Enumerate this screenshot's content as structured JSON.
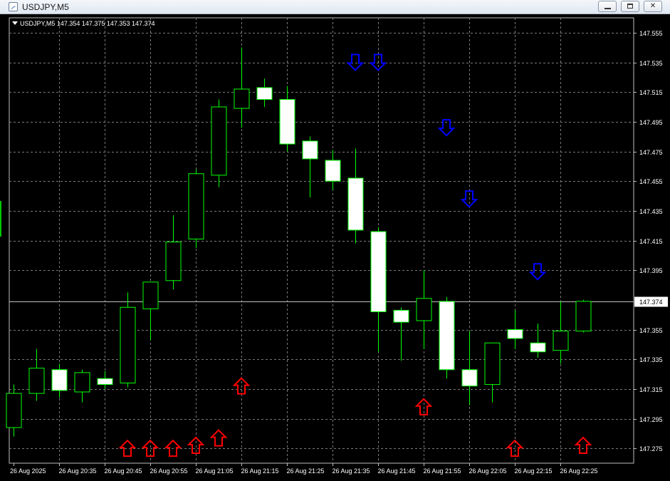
{
  "window": {
    "title": "USDJPY,M5"
  },
  "chart_header": {
    "symbol_line": "USDJPY,M5  147.354 147.375 147.353 147.374"
  },
  "colors": {
    "background": "#000000",
    "bull_body": "#000000",
    "bear_body": "#ffffff",
    "candle_outline": "#00ff00",
    "grid": "#7a7a7a",
    "axis_text": "#ffffff",
    "up_arrow": "#ff0000",
    "down_arrow": "#0000ff",
    "price_line": "#c0c0c0"
  },
  "chart_data": {
    "type": "candlestick",
    "symbol": "USDJPY",
    "timeframe": "M5",
    "ylim": [
      147.265,
      147.565
    ],
    "y_ticks": [
      "147.555",
      "147.535",
      "147.515",
      "147.495",
      "147.475",
      "147.455",
      "147.435",
      "147.415",
      "147.395",
      "147.374",
      "147.355",
      "147.335",
      "147.315",
      "147.295",
      "147.275"
    ],
    "x_labels": [
      {
        "index": 0,
        "text": "26 Aug 2025"
      },
      {
        "index": 2,
        "text": "26 Aug 20:35"
      },
      {
        "index": 4,
        "text": "26 Aug 20:45"
      },
      {
        "index": 6,
        "text": "26 Aug 20:55"
      },
      {
        "index": 8,
        "text": "26 Aug 21:05"
      },
      {
        "index": 10,
        "text": "26 Aug 21:15"
      },
      {
        "index": 12,
        "text": "26 Aug 21:25"
      },
      {
        "index": 14,
        "text": "26 Aug 21:35"
      },
      {
        "index": 16,
        "text": "26 Aug 21:45"
      },
      {
        "index": 18,
        "text": "26 Aug 21:55"
      },
      {
        "index": 20,
        "text": "26 Aug 22:05"
      },
      {
        "index": 22,
        "text": "26 Aug 22:15"
      },
      {
        "index": 24,
        "text": "26 Aug 22:25"
      }
    ],
    "current_price": "147.374",
    "candles": [
      {
        "o": 147.289,
        "h": 147.318,
        "l": 147.283,
        "c": 147.312
      },
      {
        "o": 147.312,
        "h": 147.342,
        "l": 147.307,
        "c": 147.329
      },
      {
        "o": 147.328,
        "h": 147.332,
        "l": 147.309,
        "c": 147.314
      },
      {
        "o": 147.313,
        "h": 147.328,
        "l": 147.306,
        "c": 147.326
      },
      {
        "o": 147.322,
        "h": 147.327,
        "l": 147.315,
        "c": 147.318
      },
      {
        "o": 147.319,
        "h": 147.38,
        "l": 147.316,
        "c": 147.37
      },
      {
        "o": 147.369,
        "h": 147.387,
        "l": 147.348,
        "c": 147.387
      },
      {
        "o": 147.388,
        "h": 147.432,
        "l": 147.382,
        "c": 147.414
      },
      {
        "o": 147.416,
        "h": 147.463,
        "l": 147.41,
        "c": 147.46
      },
      {
        "o": 147.459,
        "h": 147.51,
        "l": 147.451,
        "c": 147.505
      },
      {
        "o": 147.504,
        "h": 147.545,
        "l": 147.491,
        "c": 147.517
      },
      {
        "o": 147.518,
        "h": 147.524,
        "l": 147.505,
        "c": 147.51
      },
      {
        "o": 147.51,
        "h": 147.519,
        "l": 147.475,
        "c": 147.48
      },
      {
        "o": 147.482,
        "h": 147.485,
        "l": 147.444,
        "c": 147.47
      },
      {
        "o": 147.469,
        "h": 147.476,
        "l": 147.449,
        "c": 147.455
      },
      {
        "o": 147.457,
        "h": 147.477,
        "l": 147.413,
        "c": 147.422
      },
      {
        "o": 147.421,
        "h": 147.424,
        "l": 147.34,
        "c": 147.367
      },
      {
        "o": 147.368,
        "h": 147.37,
        "l": 147.334,
        "c": 147.36
      },
      {
        "o": 147.361,
        "h": 147.395,
        "l": 147.342,
        "c": 147.376
      },
      {
        "o": 147.374,
        "h": 147.377,
        "l": 147.322,
        "c": 147.328
      },
      {
        "o": 147.328,
        "h": 147.354,
        "l": 147.304,
        "c": 147.317
      },
      {
        "o": 147.318,
        "h": 147.345,
        "l": 147.306,
        "c": 147.346
      },
      {
        "o": 147.355,
        "h": 147.368,
        "l": 147.342,
        "c": 147.349
      },
      {
        "o": 147.346,
        "h": 147.359,
        "l": 147.336,
        "c": 147.34
      },
      {
        "o": 147.341,
        "h": 147.374,
        "l": 147.332,
        "c": 147.354
      },
      {
        "o": 147.354,
        "h": 147.375,
        "l": 147.353,
        "c": 147.374
      }
    ],
    "signals": [
      {
        "index": 5,
        "dir": "up",
        "price": 147.275
      },
      {
        "index": 6,
        "dir": "up",
        "price": 147.275
      },
      {
        "index": 7,
        "dir": "up",
        "price": 147.275
      },
      {
        "index": 8,
        "dir": "up",
        "price": 147.277
      },
      {
        "index": 9,
        "dir": "up",
        "price": 147.282
      },
      {
        "index": 10,
        "dir": "up",
        "price": 147.317
      },
      {
        "index": 15,
        "dir": "down",
        "price": 147.535
      },
      {
        "index": 16,
        "dir": "down",
        "price": 147.535
      },
      {
        "index": 18,
        "dir": "up",
        "price": 147.303
      },
      {
        "index": 19,
        "dir": "down",
        "price": 147.491
      },
      {
        "index": 20,
        "dir": "down",
        "price": 147.443
      },
      {
        "index": 22,
        "dir": "up",
        "price": 147.275
      },
      {
        "index": 23,
        "dir": "down",
        "price": 147.394
      },
      {
        "index": 25,
        "dir": "up",
        "price": 147.277
      }
    ]
  }
}
